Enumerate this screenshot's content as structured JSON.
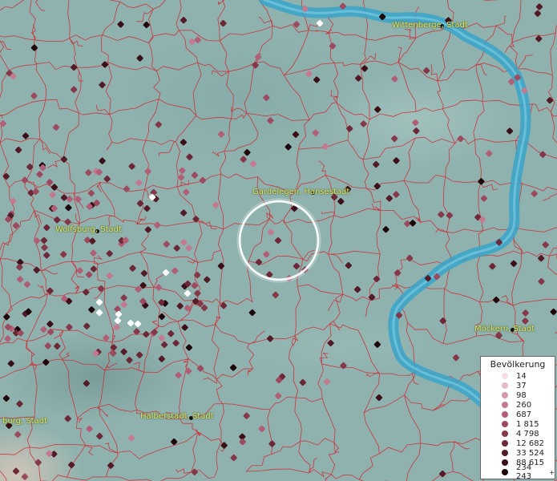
{
  "map": {
    "cities": [
      {
        "id": "wittenberge",
        "name": "Wittenberge, Stadt"
      },
      {
        "id": "gardelegen",
        "name": "Gardelegen, Hansestadt"
      },
      {
        "id": "wolfsburg",
        "name": "Wolfsburg, Stadt"
      },
      {
        "id": "moeckern",
        "name": "Möckern, Stadt"
      },
      {
        "id": "halberstadt",
        "name": "Halberstadt, Stadt"
      },
      {
        "id": "magdeburg",
        "name": "burg, Stadt"
      }
    ],
    "colors": {
      "background": "#8fb2ae",
      "river": "#3aa3c9",
      "boundary": "#d4212a",
      "city_label": "#e6e36a",
      "highlight_ring": "#ffffff"
    }
  },
  "legend": {
    "title": "Bevölkerung",
    "items": [
      {
        "label": "14",
        "color": "#f4dfe8"
      },
      {
        "label": "37",
        "color": "#e4bccb"
      },
      {
        "label": "98",
        "color": "#d399ad"
      },
      {
        "label": "260",
        "color": "#c27a91"
      },
      {
        "label": "687",
        "color": "#b05f77"
      },
      {
        "label": "1 815",
        "color": "#9c4a5f"
      },
      {
        "label": "4 798",
        "color": "#853849"
      },
      {
        "label": "12 682",
        "color": "#6c2837"
      },
      {
        "label": "33 524",
        "color": "#521b27"
      },
      {
        "label": "88 615",
        "color": "#3a0f18"
      },
      {
        "label": "234 243",
        "color": "#1f060b",
        "suffix": "+"
      }
    ]
  }
}
